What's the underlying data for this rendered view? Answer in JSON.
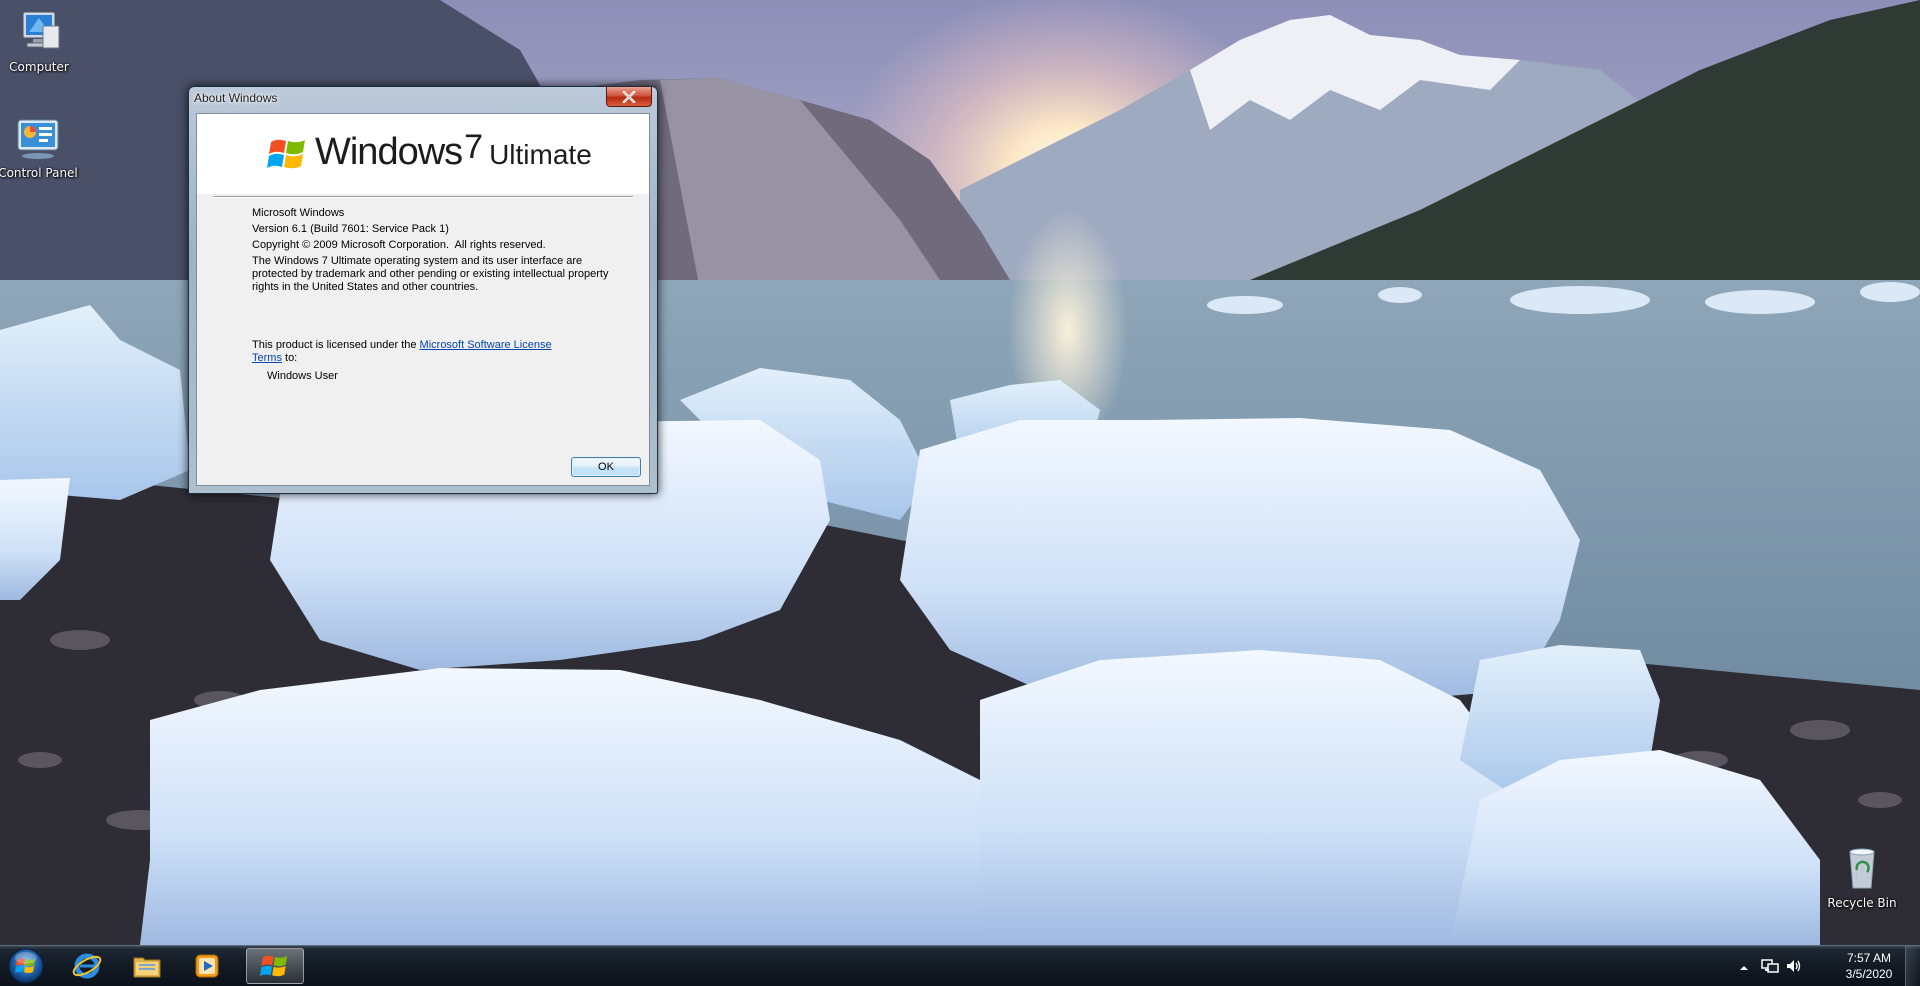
{
  "desktop": {
    "icons": [
      {
        "label": "Computer"
      },
      {
        "label": "Control Panel"
      },
      {
        "label": "Recycle Bin"
      }
    ]
  },
  "dialog": {
    "title": "About Windows",
    "brand": {
      "word": "Windows",
      "version": "7",
      "edition": "Ultimate"
    },
    "lines": [
      "Microsoft Windows",
      "Version 6.1 (Build 7601: Service Pack 1)",
      "Copyright © 2009 Microsoft Corporation.  All rights reserved.",
      "The Windows 7 Ultimate operating system and its user interface are protected by trademark and other pending or existing intellectual property rights in the United States and other countries."
    ],
    "license_prefix": "This product is licensed under the ",
    "license_link": "Microsoft Software License Terms",
    "license_suffix": " to:",
    "licensed_user": "Windows User",
    "ok_label": "OK"
  },
  "taskbar": {
    "pinned": [
      {
        "icon": "internet-explorer-icon"
      },
      {
        "icon": "windows-explorer-icon"
      },
      {
        "icon": "media-player-icon"
      },
      {
        "icon": "about-windows-task-icon",
        "active": true
      }
    ],
    "clock": {
      "time": "7:57 AM",
      "date": "3/5/2020"
    }
  },
  "colors": {
    "taskbar": "#121a24",
    "dialog_frame": "#aebfce",
    "link": "#0645ad",
    "close_button": "#c8452b"
  }
}
